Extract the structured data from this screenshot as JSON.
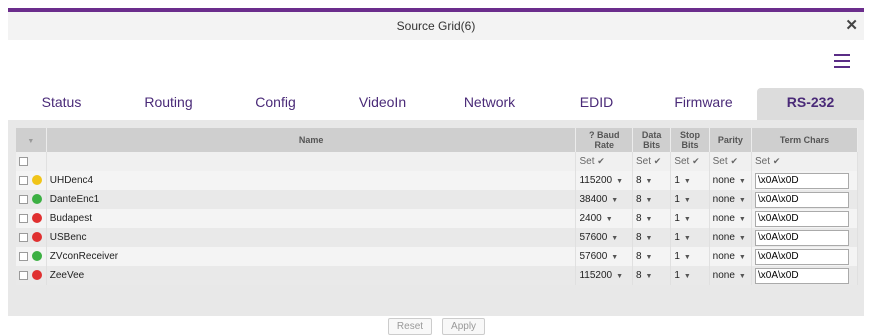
{
  "window": {
    "title": "Source Grid(6)",
    "close_glyph": "✕"
  },
  "tabs": [
    {
      "label": "Status"
    },
    {
      "label": "Routing"
    },
    {
      "label": "Config"
    },
    {
      "label": "VideoIn"
    },
    {
      "label": "Network"
    },
    {
      "label": "EDID"
    },
    {
      "label": "Firmware"
    },
    {
      "label": "RS-232",
      "active": true
    }
  ],
  "table": {
    "headers": {
      "name": "Name",
      "baud": "Baud Rate",
      "data_bits": "Data Bits",
      "stop_bits": "Stop Bits",
      "parity": "Parity",
      "term": "Term Chars",
      "help": "?"
    },
    "set_label": "Set",
    "set_check": "✔",
    "rows": [
      {
        "name": "UHDenc4",
        "status": "#f0c419",
        "baud": "115200",
        "data": "8",
        "stop": "1",
        "parity": "none",
        "term": "\\x0A\\x0D"
      },
      {
        "name": "DanteEnc1",
        "status": "#3cb043",
        "baud": "38400",
        "data": "8",
        "stop": "1",
        "parity": "none",
        "term": "\\x0A\\x0D"
      },
      {
        "name": "Budapest",
        "status": "#e03030",
        "baud": "2400",
        "data": "8",
        "stop": "1",
        "parity": "none",
        "term": "\\x0A\\x0D"
      },
      {
        "name": "USBenc",
        "status": "#e03030",
        "baud": "57600",
        "data": "8",
        "stop": "1",
        "parity": "none",
        "term": "\\x0A\\x0D"
      },
      {
        "name": "ZVconReceiver",
        "status": "#3cb043",
        "baud": "57600",
        "data": "8",
        "stop": "1",
        "parity": "none",
        "term": "\\x0A\\x0D"
      },
      {
        "name": "ZeeVee",
        "status": "#e03030",
        "baud": "115200",
        "data": "8",
        "stop": "1",
        "parity": "none",
        "term": "\\x0A\\x0D"
      }
    ]
  },
  "actions": {
    "reset": "Reset",
    "apply": "Apply"
  },
  "colors": {
    "accent": "#6b2d8c",
    "tab_text": "#4a2a78"
  }
}
